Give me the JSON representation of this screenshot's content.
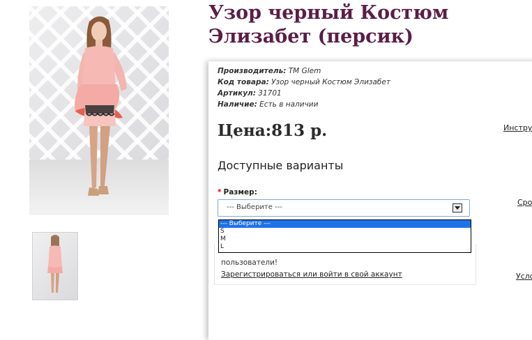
{
  "product": {
    "title": "Узор черный Костюм Элизабет (персик)",
    "manufacturer_label": "Производитель:",
    "manufacturer_value": "ТМ Glem",
    "code_label": "Код товара:",
    "code_value": "Узор черный Костюм Элизабет",
    "sku_label": "Артикул:",
    "sku_value": "31701",
    "stock_label": "Наличие:",
    "stock_value": "Есть в наличии",
    "price": "Цена:813 р."
  },
  "options": {
    "heading": "Доступные варианты",
    "size_label": "Размер:",
    "required_mark": "*",
    "select_value": "--- Выберите ---",
    "dropdown_items": [
      "--- Выберите ---",
      "S",
      "M",
      "L"
    ]
  },
  "notice": {
    "users_text": "пользователи!",
    "register_link": "Зарегистрироваться или войти в свой аккаунт"
  },
  "side_links": {
    "instructions": "Инстру",
    "delivery": "Сро",
    "conditions": "Усло"
  },
  "icons": {
    "select_arrow": "chevron-down-icon"
  },
  "colors": {
    "title": "#5a1e47",
    "required": "#e00000",
    "selected_option": "#1e72e8",
    "select_border": "#7fa9d8"
  }
}
